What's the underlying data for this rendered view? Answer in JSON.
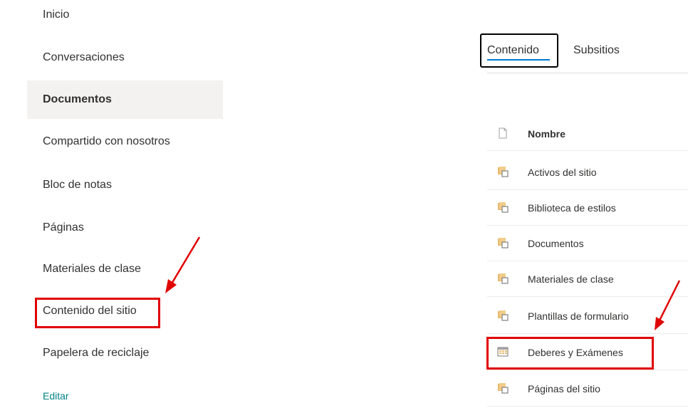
{
  "nav": {
    "items": [
      {
        "label": "Inicio"
      },
      {
        "label": "Conversaciones"
      },
      {
        "label": "Documentos"
      },
      {
        "label": "Compartido con nosotros"
      },
      {
        "label": "Bloc de notas"
      },
      {
        "label": "Páginas"
      },
      {
        "label": "Materiales de clase"
      },
      {
        "label": "Contenido del sitio"
      },
      {
        "label": "Papelera de reciclaje"
      }
    ],
    "edit_label": "Editar"
  },
  "tabs": {
    "content_label": "Contenido",
    "subsites_label": "Subsitios"
  },
  "list": {
    "header_label": "Nombre",
    "rows": [
      {
        "label": "Activos del sitio",
        "icon": "library-icon"
      },
      {
        "label": "Biblioteca de estilos",
        "icon": "library-icon"
      },
      {
        "label": "Documentos",
        "icon": "library-icon"
      },
      {
        "label": "Materiales de clase",
        "icon": "library-icon"
      },
      {
        "label": "Plantillas de formulario",
        "icon": "library-icon"
      },
      {
        "label": "Deberes y Exámenes",
        "icon": "list-icon"
      },
      {
        "label": "Páginas del sitio",
        "icon": "library-icon"
      }
    ]
  },
  "colors": {
    "accent": "#0078d4",
    "edit_link": "#038387",
    "highlight": "#e00000",
    "selected_bg": "#f3f2f1"
  }
}
